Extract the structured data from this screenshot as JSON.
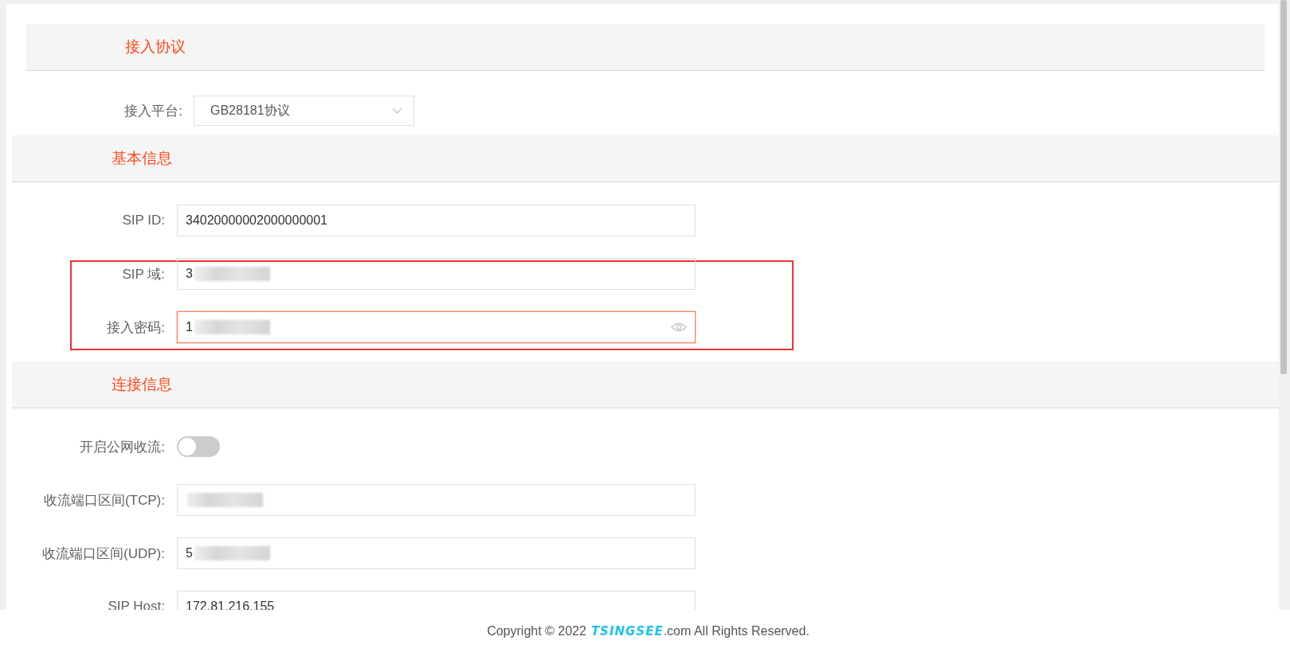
{
  "sections": [
    {
      "title": "接入协议",
      "kind": "inset",
      "rows": [
        {
          "kind": "select",
          "label": "接入平台:",
          "value": "GB28181协议"
        }
      ]
    },
    {
      "title": "基本信息",
      "kind": "full",
      "rows": [
        {
          "kind": "input",
          "label": "SIP ID:",
          "value": "34020000002000000001"
        },
        {
          "kind": "input",
          "label": "SIP 域:",
          "value": "3",
          "redacted": true,
          "highlighted": true
        },
        {
          "kind": "password",
          "label": "接入密码:",
          "value": "1",
          "redacted": true,
          "highlighted": true,
          "focused": true
        }
      ]
    },
    {
      "title": "连接信息",
      "kind": "full",
      "rows": [
        {
          "kind": "toggle",
          "label": "开启公网收流:",
          "on": false
        },
        {
          "kind": "input",
          "label": "收流端口区间(TCP):",
          "redacted": true
        },
        {
          "kind": "input",
          "label": "收流端口区间(UDP):",
          "value": "5",
          "redacted": true
        },
        {
          "kind": "input",
          "label": "SIP Host:",
          "value": "172.81.216.155"
        }
      ]
    }
  ],
  "footer": {
    "copyright": "Copyright © 2022",
    "brand": "TSINGSEE",
    "domain": ".com All Rights Reserved."
  }
}
